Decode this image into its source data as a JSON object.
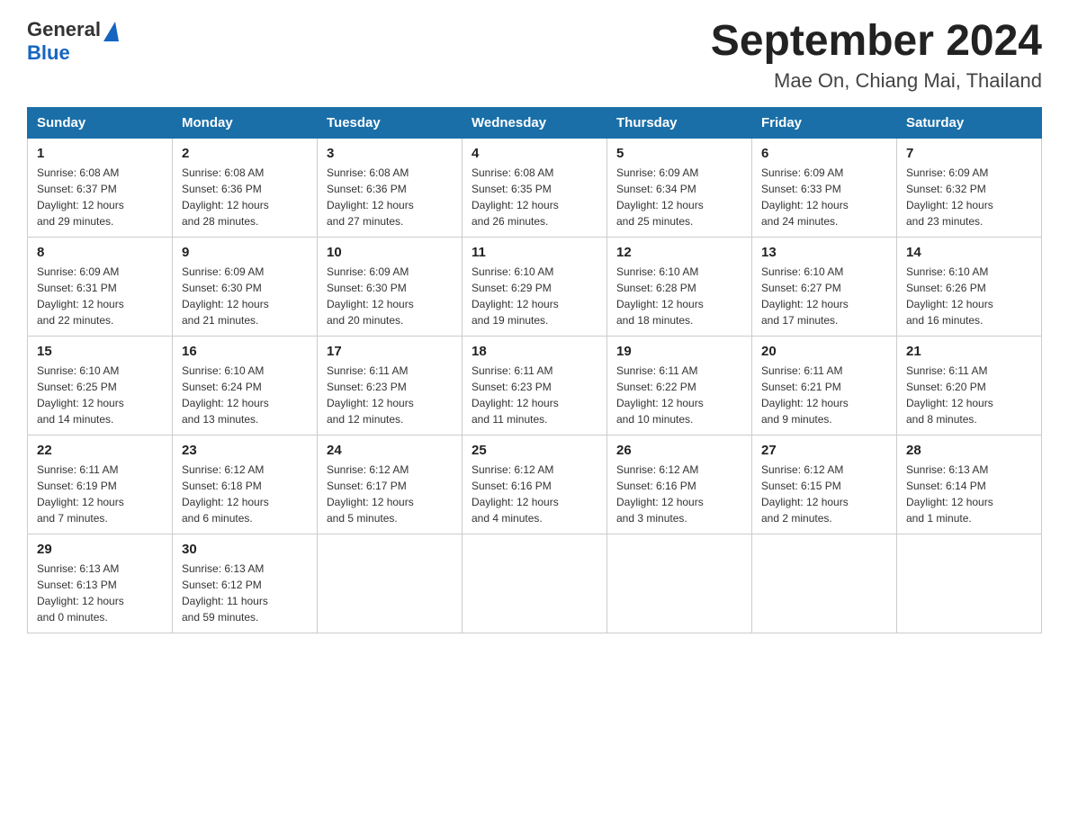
{
  "header": {
    "logo": {
      "general": "General",
      "blue": "Blue"
    },
    "title": "September 2024",
    "subtitle": "Mae On, Chiang Mai, Thailand"
  },
  "weekdays": [
    "Sunday",
    "Monday",
    "Tuesday",
    "Wednesday",
    "Thursday",
    "Friday",
    "Saturday"
  ],
  "weeks": [
    [
      {
        "day": "1",
        "sunrise": "6:08 AM",
        "sunset": "6:37 PM",
        "daylight": "12 hours and 29 minutes."
      },
      {
        "day": "2",
        "sunrise": "6:08 AM",
        "sunset": "6:36 PM",
        "daylight": "12 hours and 28 minutes."
      },
      {
        "day": "3",
        "sunrise": "6:08 AM",
        "sunset": "6:36 PM",
        "daylight": "12 hours and 27 minutes."
      },
      {
        "day": "4",
        "sunrise": "6:08 AM",
        "sunset": "6:35 PM",
        "daylight": "12 hours and 26 minutes."
      },
      {
        "day": "5",
        "sunrise": "6:09 AM",
        "sunset": "6:34 PM",
        "daylight": "12 hours and 25 minutes."
      },
      {
        "day": "6",
        "sunrise": "6:09 AM",
        "sunset": "6:33 PM",
        "daylight": "12 hours and 24 minutes."
      },
      {
        "day": "7",
        "sunrise": "6:09 AM",
        "sunset": "6:32 PM",
        "daylight": "12 hours and 23 minutes."
      }
    ],
    [
      {
        "day": "8",
        "sunrise": "6:09 AM",
        "sunset": "6:31 PM",
        "daylight": "12 hours and 22 minutes."
      },
      {
        "day": "9",
        "sunrise": "6:09 AM",
        "sunset": "6:30 PM",
        "daylight": "12 hours and 21 minutes."
      },
      {
        "day": "10",
        "sunrise": "6:09 AM",
        "sunset": "6:30 PM",
        "daylight": "12 hours and 20 minutes."
      },
      {
        "day": "11",
        "sunrise": "6:10 AM",
        "sunset": "6:29 PM",
        "daylight": "12 hours and 19 minutes."
      },
      {
        "day": "12",
        "sunrise": "6:10 AM",
        "sunset": "6:28 PM",
        "daylight": "12 hours and 18 minutes."
      },
      {
        "day": "13",
        "sunrise": "6:10 AM",
        "sunset": "6:27 PM",
        "daylight": "12 hours and 17 minutes."
      },
      {
        "day": "14",
        "sunrise": "6:10 AM",
        "sunset": "6:26 PM",
        "daylight": "12 hours and 16 minutes."
      }
    ],
    [
      {
        "day": "15",
        "sunrise": "6:10 AM",
        "sunset": "6:25 PM",
        "daylight": "12 hours and 14 minutes."
      },
      {
        "day": "16",
        "sunrise": "6:10 AM",
        "sunset": "6:24 PM",
        "daylight": "12 hours and 13 minutes."
      },
      {
        "day": "17",
        "sunrise": "6:11 AM",
        "sunset": "6:23 PM",
        "daylight": "12 hours and 12 minutes."
      },
      {
        "day": "18",
        "sunrise": "6:11 AM",
        "sunset": "6:23 PM",
        "daylight": "12 hours and 11 minutes."
      },
      {
        "day": "19",
        "sunrise": "6:11 AM",
        "sunset": "6:22 PM",
        "daylight": "12 hours and 10 minutes."
      },
      {
        "day": "20",
        "sunrise": "6:11 AM",
        "sunset": "6:21 PM",
        "daylight": "12 hours and 9 minutes."
      },
      {
        "day": "21",
        "sunrise": "6:11 AM",
        "sunset": "6:20 PM",
        "daylight": "12 hours and 8 minutes."
      }
    ],
    [
      {
        "day": "22",
        "sunrise": "6:11 AM",
        "sunset": "6:19 PM",
        "daylight": "12 hours and 7 minutes."
      },
      {
        "day": "23",
        "sunrise": "6:12 AM",
        "sunset": "6:18 PM",
        "daylight": "12 hours and 6 minutes."
      },
      {
        "day": "24",
        "sunrise": "6:12 AM",
        "sunset": "6:17 PM",
        "daylight": "12 hours and 5 minutes."
      },
      {
        "day": "25",
        "sunrise": "6:12 AM",
        "sunset": "6:16 PM",
        "daylight": "12 hours and 4 minutes."
      },
      {
        "day": "26",
        "sunrise": "6:12 AM",
        "sunset": "6:16 PM",
        "daylight": "12 hours and 3 minutes."
      },
      {
        "day": "27",
        "sunrise": "6:12 AM",
        "sunset": "6:15 PM",
        "daylight": "12 hours and 2 minutes."
      },
      {
        "day": "28",
        "sunrise": "6:13 AM",
        "sunset": "6:14 PM",
        "daylight": "12 hours and 1 minute."
      }
    ],
    [
      {
        "day": "29",
        "sunrise": "6:13 AM",
        "sunset": "6:13 PM",
        "daylight": "12 hours and 0 minutes."
      },
      {
        "day": "30",
        "sunrise": "6:13 AM",
        "sunset": "6:12 PM",
        "daylight": "11 hours and 59 minutes."
      },
      null,
      null,
      null,
      null,
      null
    ]
  ],
  "labels": {
    "sunrise": "Sunrise:",
    "sunset": "Sunset:",
    "daylight": "Daylight:"
  }
}
